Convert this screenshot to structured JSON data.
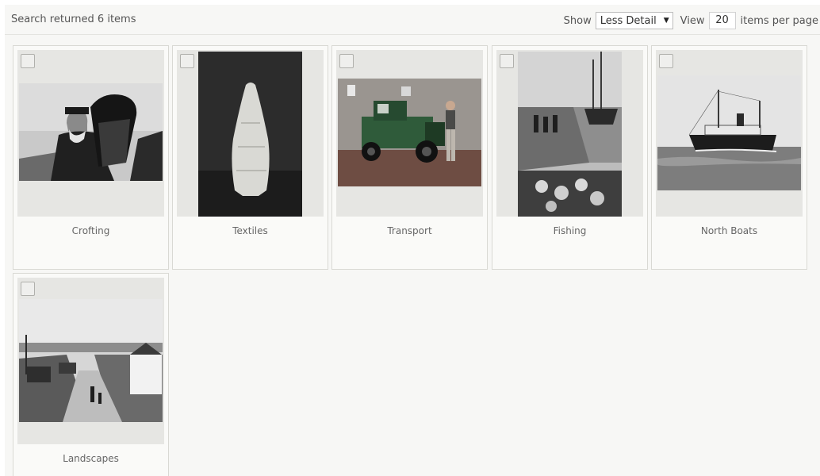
{
  "results": {
    "summary": "Search returned 6 items"
  },
  "controls": {
    "show_label": "Show",
    "detail_value": "Less Detail",
    "view_label": "View",
    "per_page_value": "20",
    "per_page_suffix": "items per page"
  },
  "items": [
    {
      "caption": "Crofting"
    },
    {
      "caption": "Textiles"
    },
    {
      "caption": "Transport"
    },
    {
      "caption": "Fishing"
    },
    {
      "caption": "North Boats"
    },
    {
      "caption": "Landscapes"
    }
  ]
}
